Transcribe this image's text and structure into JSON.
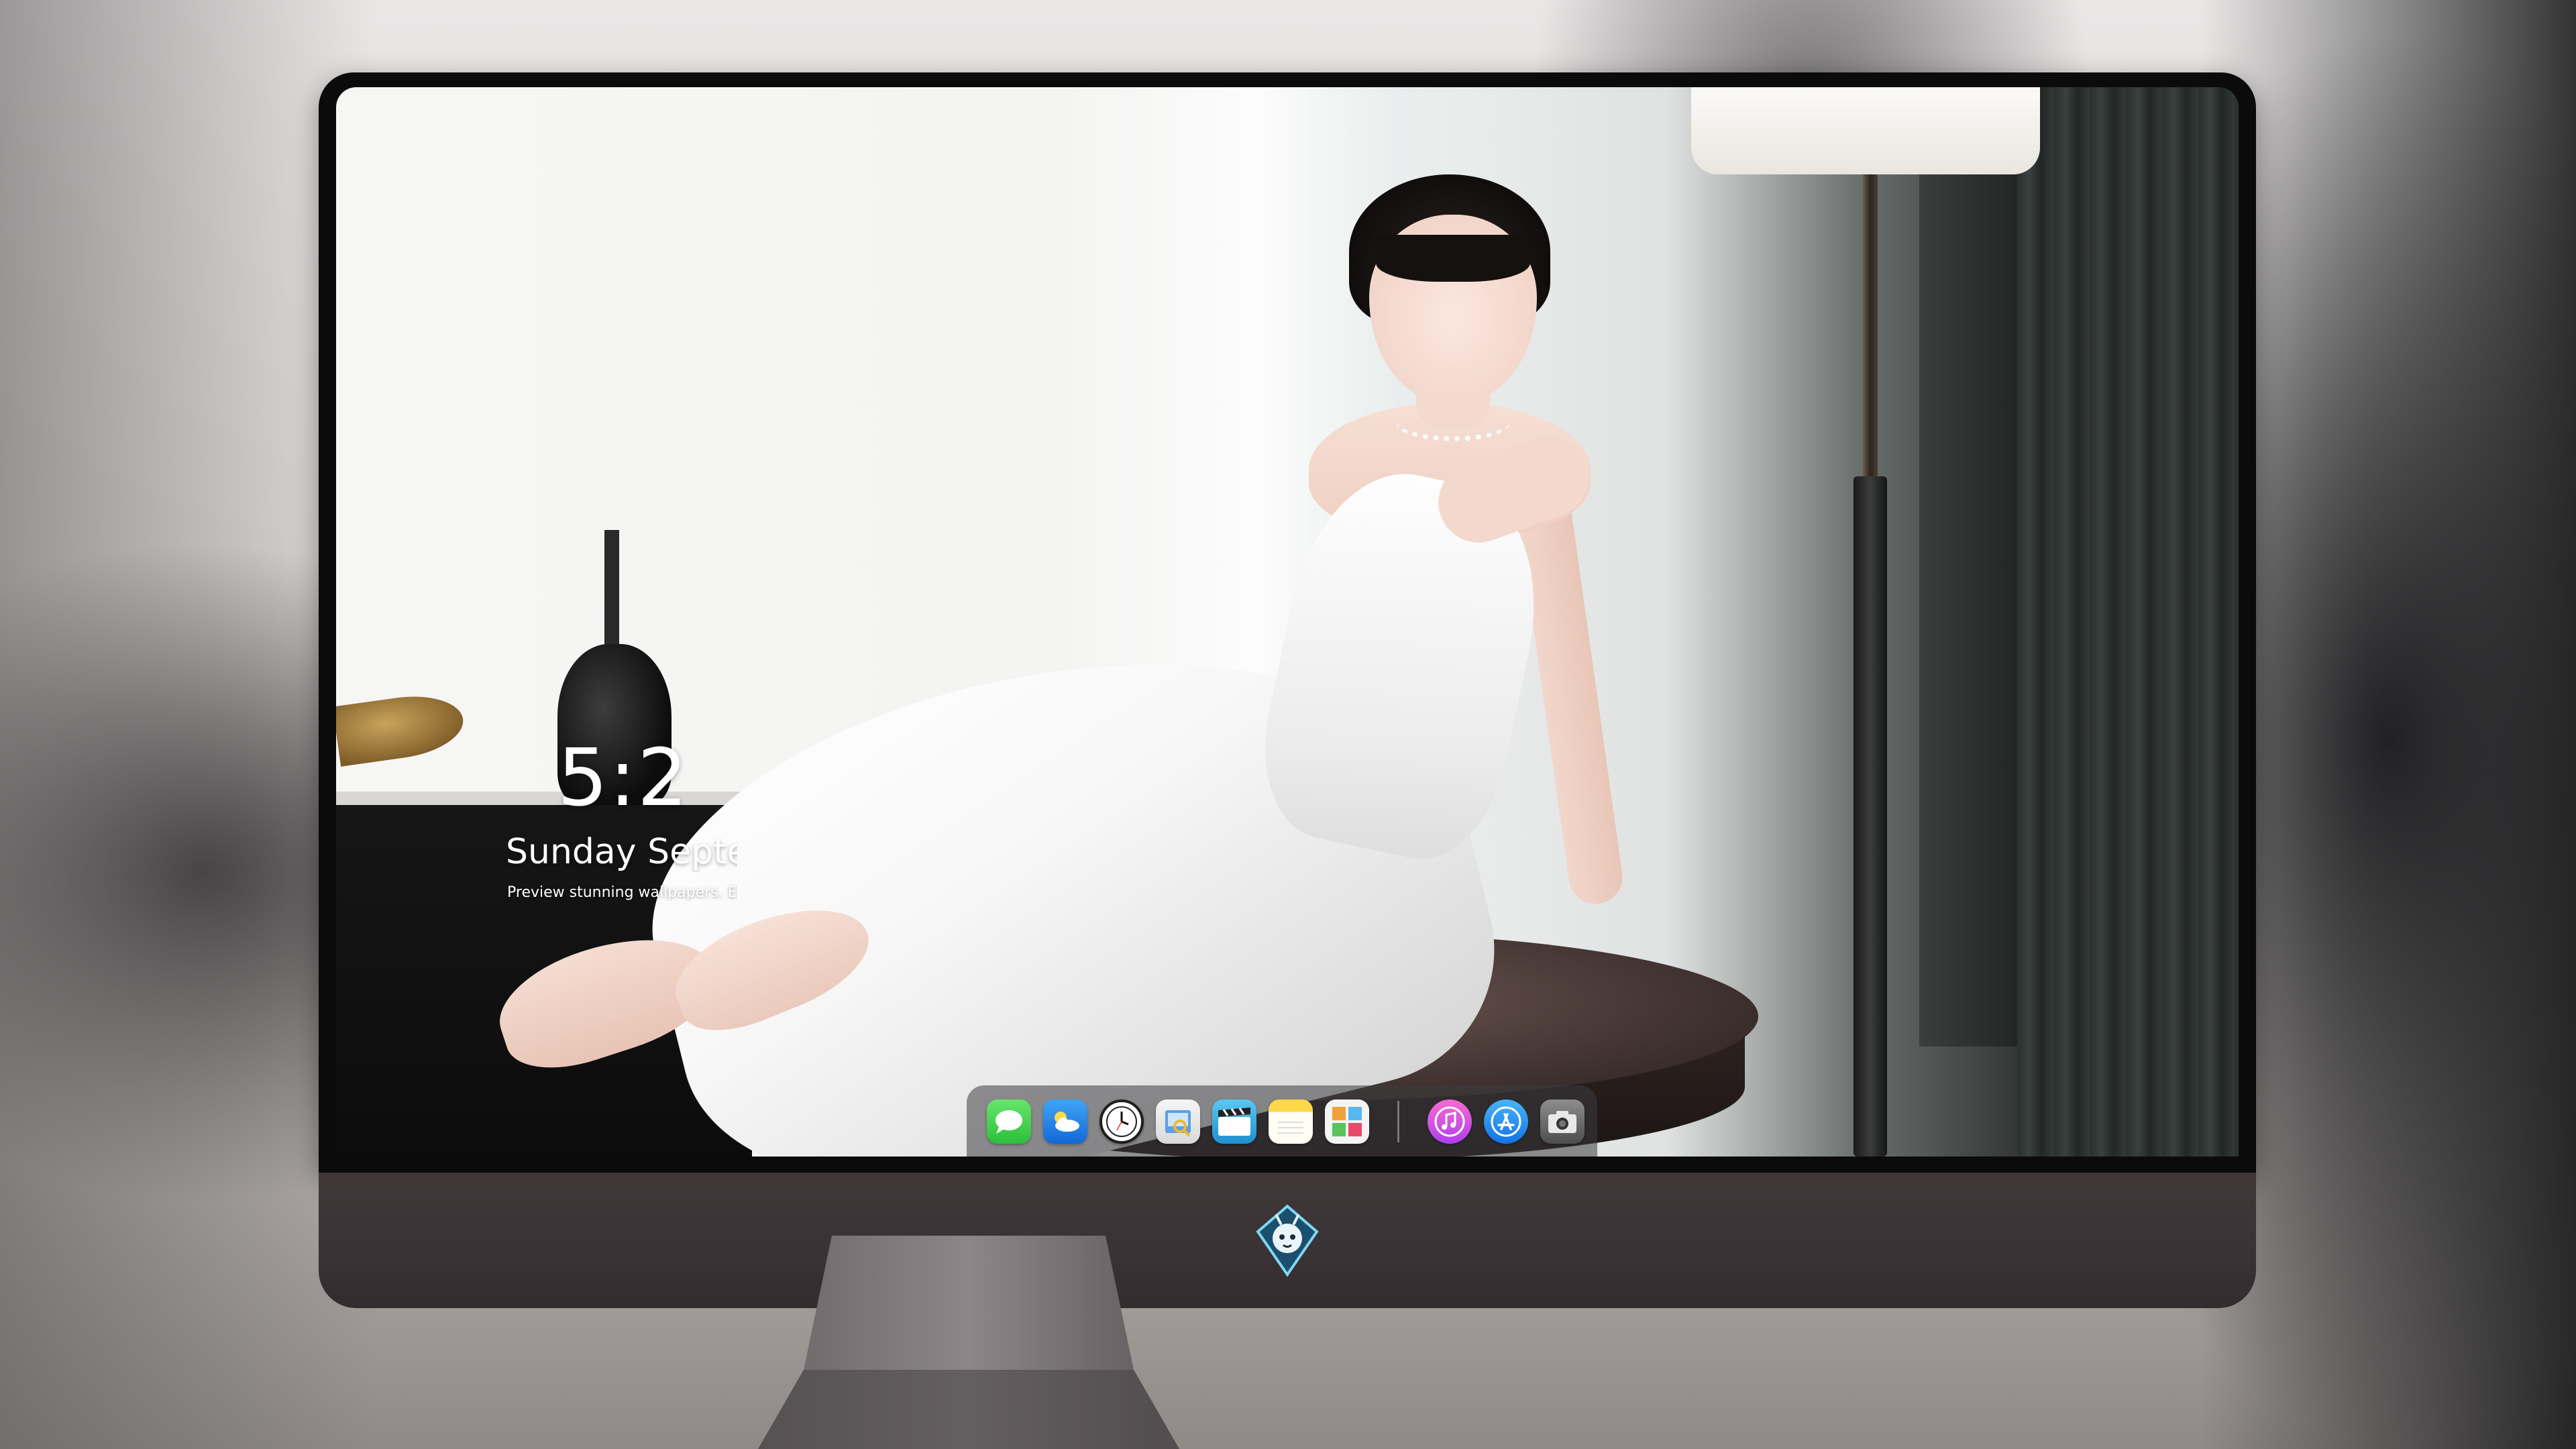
{
  "lock_screen": {
    "time": "5:2",
    "date": "Sunday Septe",
    "caption": "Preview stunning wallpapers. Elev"
  },
  "dock": {
    "apps": [
      {
        "name": "Messages",
        "icon": "messages-icon"
      },
      {
        "name": "Weather",
        "icon": "weather-icon"
      },
      {
        "name": "Clock",
        "icon": "clock-icon"
      },
      {
        "name": "Preview",
        "icon": "preview-icon"
      },
      {
        "name": "Clips",
        "icon": "clips-icon"
      },
      {
        "name": "Notes",
        "icon": "notes-icon"
      },
      {
        "name": "Photo Booth",
        "icon": "photo-grid-icon"
      },
      {
        "name": "Music",
        "icon": "music-icon"
      },
      {
        "name": "App Store",
        "icon": "app-store-icon"
      },
      {
        "name": "Camera",
        "icon": "camera-icon"
      }
    ]
  },
  "monitor": {
    "logo": "dragon-mascot-logo"
  },
  "colors": {
    "bezel": "#0b0b0c",
    "chin": "#3a3234",
    "dock_background": "rgba(60,60,64,0.55)"
  }
}
